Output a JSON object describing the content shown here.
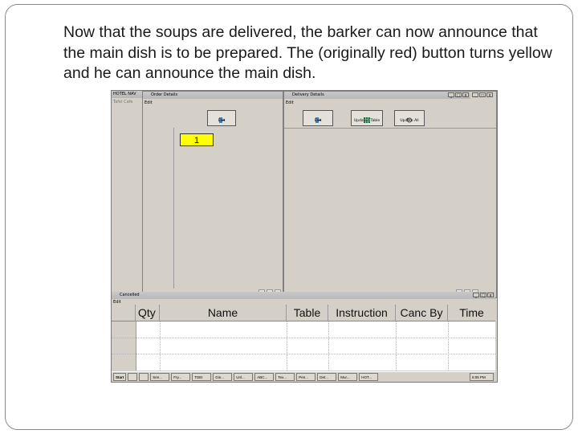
{
  "caption": "Now that the soups are delivered, the barker can now announce that the main dish is to be prepared. The (originally red) button turns yellow and he can announce the main dish.",
  "app": {
    "main_title": "HOTEL NAV",
    "main_menu": "Tafel Cafe",
    "order_window": {
      "title": "Order Details",
      "menu": "Edit",
      "exit_label": "Exit",
      "order_button_value": "1"
    },
    "delivery_window": {
      "title": "Delivery Details",
      "menu": "Edit",
      "buttons": [
        "Exit",
        "Updated Table",
        "Update All"
      ]
    },
    "grid_window": {
      "title": "Cancelled",
      "menu": "Edit",
      "columns": [
        "Qty",
        "Name",
        "Table",
        "Instruction",
        "Canc By",
        "Time"
      ]
    },
    "taskbar": {
      "start": "Start",
      "tasks": [
        "Sen...",
        "Fry...",
        "TDEI",
        "Gin...",
        "Unl...",
        "ABC...",
        "Tex...",
        "Pen...",
        "Det...",
        "Mur...",
        "HOT..."
      ],
      "clock": "6:05 PM"
    }
  }
}
